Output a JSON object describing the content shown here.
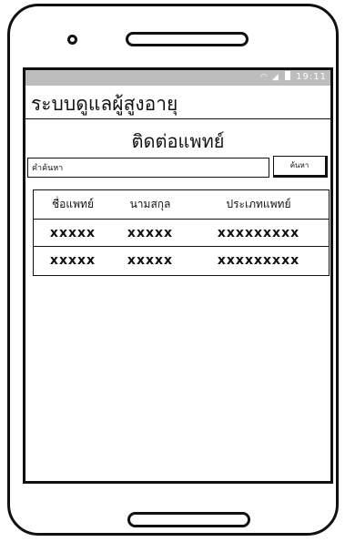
{
  "status": {
    "time": "19:11"
  },
  "app": {
    "title": "ระบบดูแลผู้สูงอายุ"
  },
  "page": {
    "title": "ติดต่อแพทย์"
  },
  "search": {
    "placeholder": "คำค้นหา",
    "button": "ค้นหา"
  },
  "table": {
    "headers": [
      "ชื่อแพทย์",
      "นามสกุล",
      "ประเภทแพทย์"
    ],
    "rows": [
      [
        "xxxxx",
        "xxxxx",
        "xxxxxxxxx"
      ],
      [
        "xxxxx",
        "xxxxx",
        "xxxxxxxxx"
      ]
    ]
  }
}
